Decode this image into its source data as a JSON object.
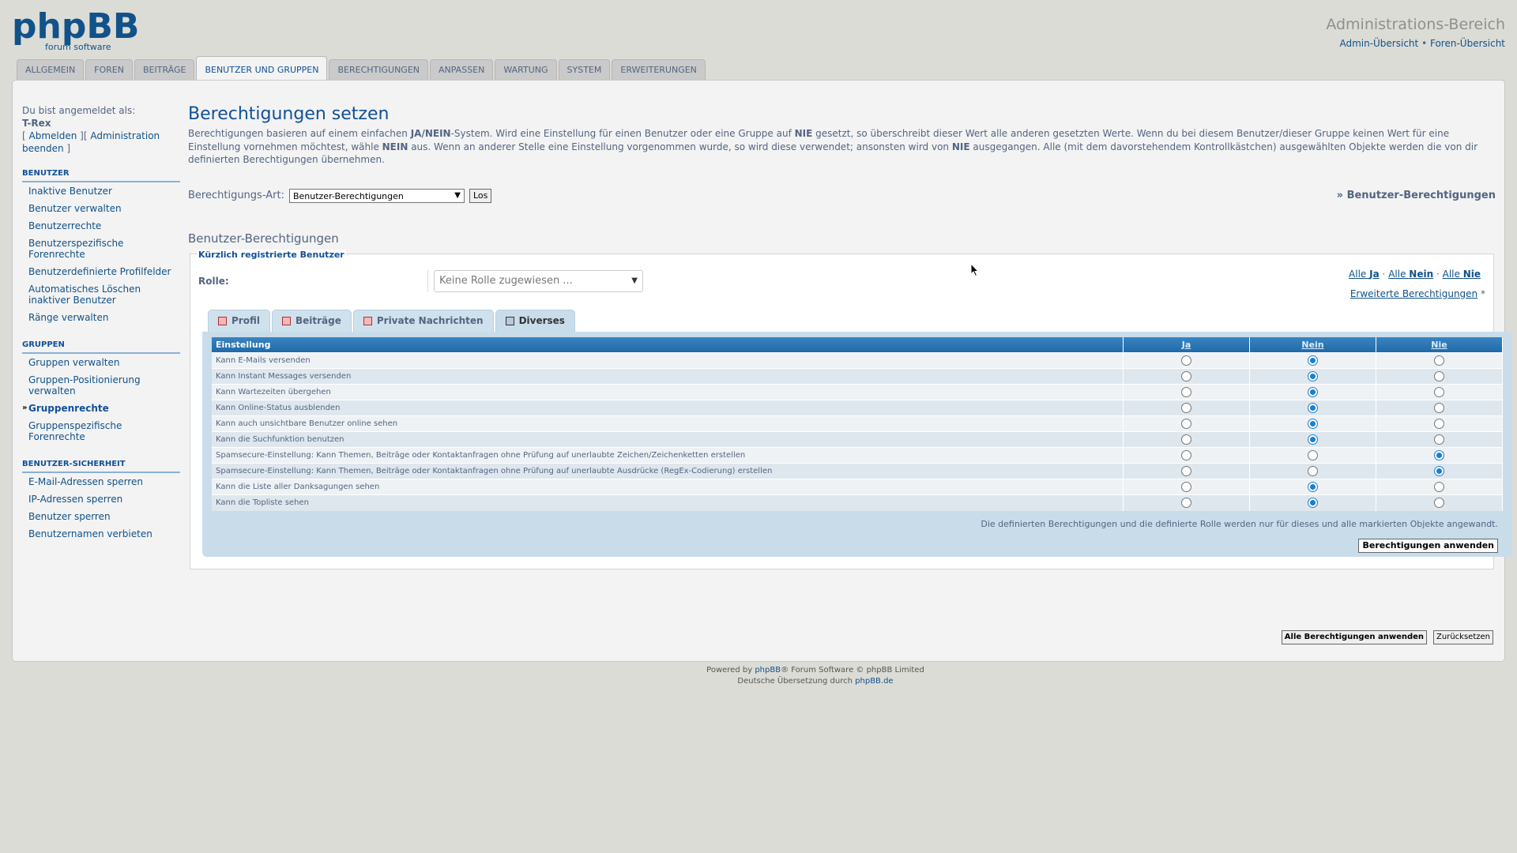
{
  "header": {
    "logo_text": "phpBB",
    "logo_subtext": "forum software",
    "title": "Administrations-Bereich",
    "link_overview": "Admin-Übersicht",
    "separator": "•",
    "link_forum": "Foren-Übersicht"
  },
  "tabs": [
    {
      "label": "Allgemein"
    },
    {
      "label": "Foren"
    },
    {
      "label": "Beiträge"
    },
    {
      "label": "Benutzer und Gruppen"
    },
    {
      "label": "Berechtigungen"
    },
    {
      "label": "Anpassen"
    },
    {
      "label": "Wartung"
    },
    {
      "label": "System"
    },
    {
      "label": "Erweiterungen"
    }
  ],
  "sidebar": {
    "logged_in_as": "Du bist angemeldet als:",
    "username": "T-Rex",
    "logout_link": "Abmelden",
    "admin_link": "Administration beenden",
    "sections": [
      {
        "title": "Benutzer",
        "items": [
          {
            "label": "Inaktive Benutzer"
          },
          {
            "label": "Benutzer verwalten"
          },
          {
            "label": "Benutzerrechte"
          },
          {
            "label": "Benutzerspezifische Forenrechte"
          },
          {
            "label": "Benutzerdefinierte Profilfelder"
          },
          {
            "label": "Automatisches Löschen inaktiver Benutzer"
          },
          {
            "label": "Ränge verwalten"
          }
        ]
      },
      {
        "title": "Gruppen",
        "items": [
          {
            "label": "Gruppen verwalten"
          },
          {
            "label": "Gruppen-Positionierung verwalten"
          },
          {
            "label": "Gruppenrechte"
          },
          {
            "label": "Gruppenspezifische Forenrechte"
          }
        ]
      },
      {
        "title": "Benutzer-Sicherheit",
        "items": [
          {
            "label": "E-Mail-Adressen sperren"
          },
          {
            "label": "IP-Adressen sperren"
          },
          {
            "label": "Benutzer sperren"
          },
          {
            "label": "Benutzernamen verbieten"
          }
        ]
      }
    ]
  },
  "main": {
    "title": "Berechtigungen setzen",
    "intro_1": "Berechtigungen basieren auf einem einfachen ",
    "intro_b1": "JA/NEIN",
    "intro_2": "-System. Wird eine Einstellung für einen Benutzer oder eine Gruppe auf ",
    "intro_b2": "NIE",
    "intro_3": " gesetzt, so überschreibt dieser Wert alle anderen gesetzten Werte. Wenn du bei diesem Benutzer/dieser Gruppe keinen Wert für eine Einstellung vornehmen möchtest, wähle ",
    "intro_b3": "NEIN",
    "intro_4": " aus. Wenn an anderer Stelle eine Einstellung vorgenommen wurde, so wird diese verwendet; ansonsten wird von ",
    "intro_b4": "NIE",
    "intro_5": " ausgegangen. Alle (mit dem davorstehendem Kontrollkästchen) ausgewählten Objekte werden die von dir definierten Berechtigungen übernehmen.",
    "perm_type_label": "Berechtigungs-Art:",
    "perm_type_value": "Benutzer-Berechtigungen",
    "go_button": "Los",
    "right_title": "» Benutzer-Berechtigungen",
    "subtitle": "Benutzer-Berechtigungen",
    "fieldset_legend": "Kürzlich registrierte Benutzer",
    "role_label": "Rolle:",
    "role_value": "Keine Rolle zugewiesen ...",
    "all_prefix": "Alle",
    "all_yes": "Ja",
    "all_no": "Nein",
    "all_never": "Nie",
    "dot": "·",
    "advanced_link": "Erweiterte Berechtigungen",
    "advanced_mark": "*",
    "categories": [
      {
        "label": "Profil"
      },
      {
        "label": "Beiträge"
      },
      {
        "label": "Private Nachrichten"
      },
      {
        "label": "Diverses"
      }
    ],
    "table": {
      "col_setting": "Einstellung",
      "col_yes": "Ja",
      "col_no": "Nein",
      "col_never": "Nie",
      "rows": [
        {
          "label": "Kann E-Mails versenden",
          "value": "no"
        },
        {
          "label": "Kann Instant Messages versenden",
          "value": "no"
        },
        {
          "label": "Kann Wartezeiten übergehen",
          "value": "no"
        },
        {
          "label": "Kann Online-Status ausblenden",
          "value": "no"
        },
        {
          "label": "Kann auch unsichtbare Benutzer online sehen",
          "value": "no"
        },
        {
          "label": "Kann die Suchfunktion benutzen",
          "value": "no"
        },
        {
          "label": "Spamsecure-Einstellung: Kann Themen, Beiträge oder Kontaktanfragen ohne Prüfung auf unerlaubte Zeichen/Zeichenketten erstellen",
          "value": "never"
        },
        {
          "label": "Spamsecure-Einstellung: Kann Themen, Beiträge oder Kontaktanfragen ohne Prüfung auf unerlaubte Ausdrücke (RegEx-Codierung) erstellen",
          "value": "never"
        },
        {
          "label": "Kann die Liste aller Danksagungen sehen",
          "value": "no"
        },
        {
          "label": "Kann die Topliste sehen",
          "value": "no"
        }
      ]
    },
    "apply_note": "Die definierten Berechtigungen und die definierte Rolle werden nur für dieses und alle markierten Objekte angewandt.",
    "apply_button": "Berechtigungen anwenden",
    "apply_all_button": "Alle Berechtigungen anwenden",
    "reset_button": "Zurücksetzen"
  },
  "footer": {
    "line1_a": "Powered by ",
    "line1_link": "phpBB",
    "line1_b": "® Forum Software © phpBB Limited",
    "line2_a": "Deutsche Übersetzung durch ",
    "line2_link": "phpBB.de"
  },
  "colors": {
    "accent": "#115098",
    "table_header": "#1f6aa8",
    "radio_selected": "#1a7fd0",
    "background": "#dcdcd6"
  }
}
